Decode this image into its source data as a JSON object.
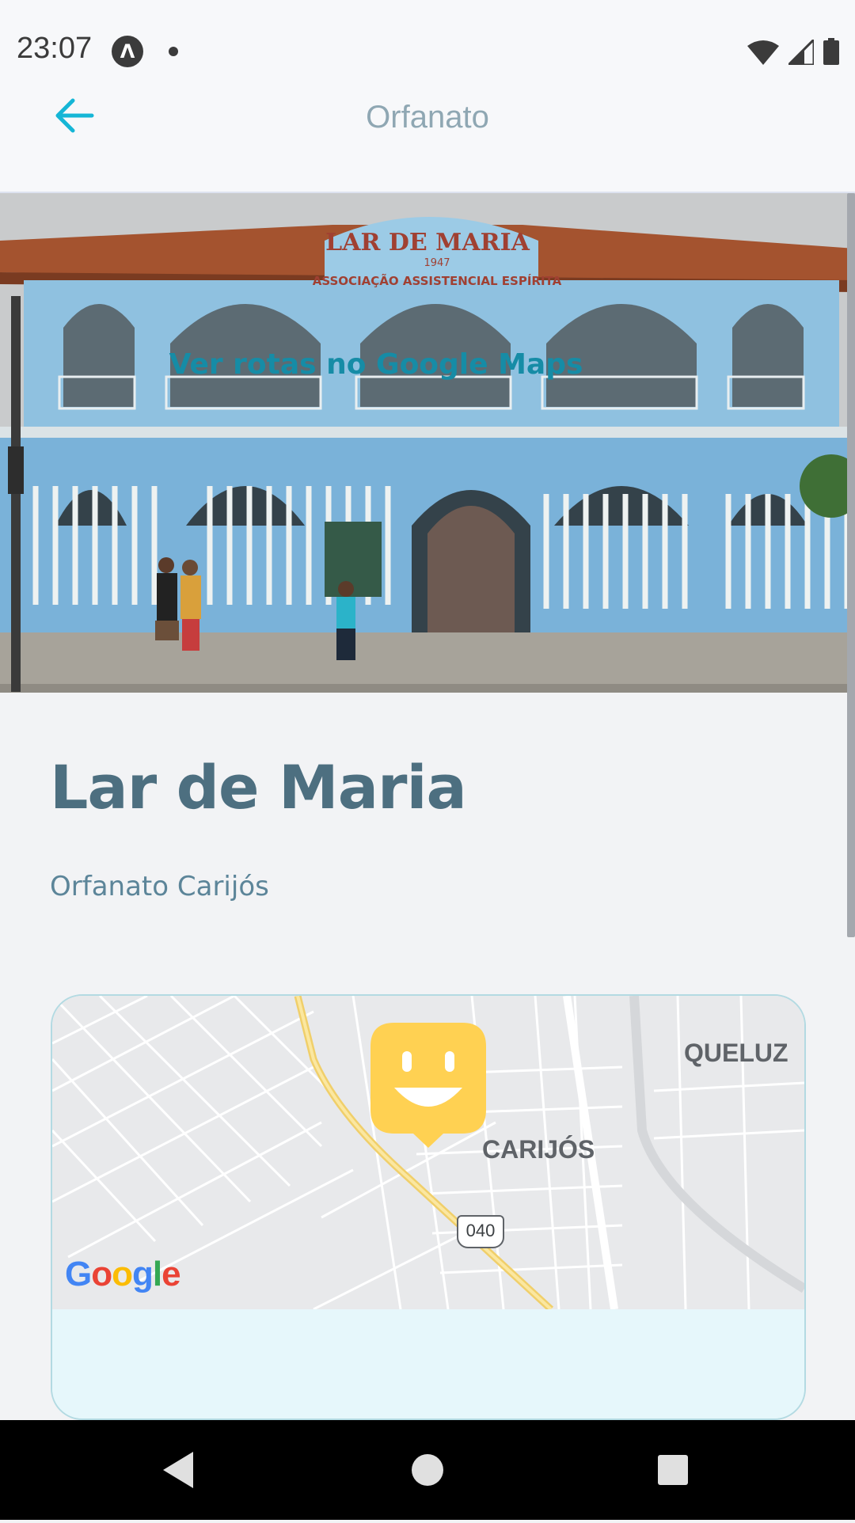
{
  "status_bar": {
    "time": "23:07",
    "app_icon_letter": "Λ"
  },
  "header": {
    "title": "Orfanato"
  },
  "orphanage": {
    "name": "Lar de Maria",
    "description": "Orfanato Carijós",
    "photo_sign_text": "LAR DE MARIA",
    "photo_sign_year": "1947",
    "photo_sign_subtitle": "ASSOCIAÇÃO ASSISTENCIAL ESPÍRITA"
  },
  "map": {
    "labels": {
      "queluz": "QUELUZ",
      "carijos": "CARIJÓS"
    },
    "route_number": "040",
    "provider_logo": "Google",
    "marker_icon": "smiley-marker-icon",
    "accent_color": "#ffd152"
  },
  "actions": {
    "routes_link": "Ver rotas no Google Maps"
  },
  "colors": {
    "title": "#4d6f80",
    "link": "#168ca6",
    "back_arrow": "#15b6d6"
  }
}
